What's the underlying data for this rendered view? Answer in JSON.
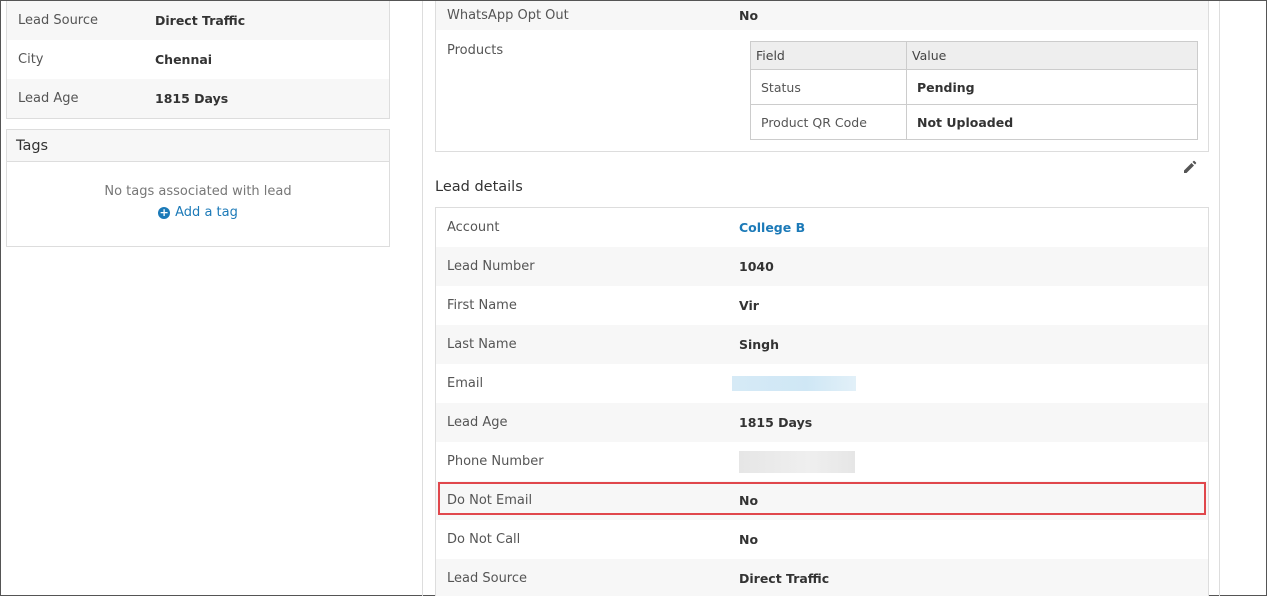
{
  "summary": {
    "rows": [
      {
        "label": "Lead Source",
        "value": "Direct Traffic"
      },
      {
        "label": "City",
        "value": "Chennai"
      },
      {
        "label": "Lead Age",
        "value": "1815 Days"
      }
    ]
  },
  "tags": {
    "title": "Tags",
    "empty_text": "No tags associated with lead",
    "add_label": "Add a tag"
  },
  "top": {
    "whatsapp": {
      "label": "WhatsApp Opt Out",
      "value": "No"
    },
    "products_label": "Products",
    "products_table": {
      "headers": [
        "Field",
        "Value"
      ],
      "rows": [
        {
          "field": "Status",
          "value": "Pending"
        },
        {
          "field": "Product QR Code",
          "value": "Not Uploaded"
        }
      ]
    }
  },
  "lead_details": {
    "title": "Lead details",
    "rows": [
      {
        "label": "Account",
        "value": "College B"
      },
      {
        "label": "Lead Number",
        "value": "1040"
      },
      {
        "label": "First Name",
        "value": "Vir"
      },
      {
        "label": "Last Name",
        "value": "Singh"
      },
      {
        "label": "Email",
        "value": ""
      },
      {
        "label": "Lead Age",
        "value": "1815 Days"
      },
      {
        "label": "Phone Number",
        "value": ""
      },
      {
        "label": "Do Not Email",
        "value": "No"
      },
      {
        "label": "Do Not Call",
        "value": "No"
      },
      {
        "label": "Lead Source",
        "value": "Direct Traffic"
      }
    ]
  },
  "colors": {
    "link": "#1c7ab8",
    "highlight": "#e0474c",
    "row_alt": "#f7f7f7"
  },
  "icons": {
    "edit": "pencil-icon",
    "add_tag": "plus-circle-icon"
  }
}
